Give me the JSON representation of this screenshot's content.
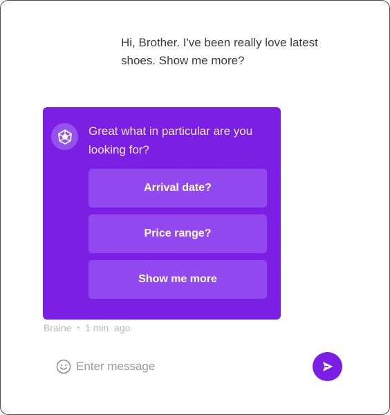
{
  "conversation": {
    "user_message": "Hi, Brother. I've been really love latest shoes. Show me more?",
    "bot": {
      "message": "Great what in particular are you looking for?",
      "options": [
        "Arrival date?",
        "Price range?",
        "Show me more"
      ],
      "sender": "Braine",
      "separator": "•",
      "time": "1 min  ago",
      "avatar_icon": "dodecahedron-logo-icon"
    }
  },
  "composer": {
    "placeholder": "Enter message",
    "emoji_icon": "smiley-icon",
    "send_icon": "send-icon"
  },
  "colors": {
    "accent": "#7a1fe3",
    "option_bg": "#9249f0",
    "avatar_bg": "#9353ec"
  }
}
